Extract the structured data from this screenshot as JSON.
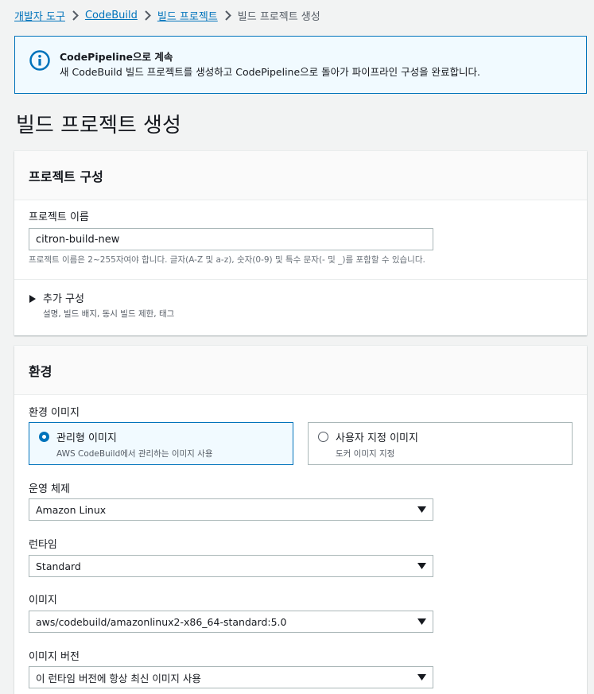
{
  "breadcrumb": {
    "items": [
      "개발자 도구",
      "CodeBuild",
      "빌드 프로젝트"
    ],
    "current": "빌드 프로젝트 생성"
  },
  "info": {
    "title": "CodePipeline으로 계속",
    "description": "새 CodeBuild 빌드 프로젝트를 생성하고 CodePipeline으로 돌아가 파이프라인 구성을 완료합니다."
  },
  "page_title": "빌드 프로젝트 생성",
  "project_config": {
    "header": "프로젝트 구성",
    "name_label": "프로젝트 이름",
    "name_value": "citron-build-new",
    "name_hint": "프로젝트 이름은 2~255자여야 합니다. 글자(A-Z 및 a-z), 숫자(0-9) 및 특수 문자(- 및 _)를 포함할 수 있습니다.",
    "additional": {
      "title": "추가 구성",
      "subtitle": "설명, 빌드 배지, 동시 빌드 제한, 태그"
    }
  },
  "environment": {
    "header": "환경",
    "image_label": "환경 이미지",
    "options": [
      {
        "title": "관리형 이미지",
        "subtitle": "AWS CodeBuild에서 관리하는 이미지 사용",
        "selected": true
      },
      {
        "title": "사용자 지정 이미지",
        "subtitle": "도커 이미지 지정",
        "selected": false
      }
    ],
    "os_label": "운영 체제",
    "os_value": "Amazon Linux",
    "runtime_label": "런타임",
    "runtime_value": "Standard",
    "image_select_label": "이미지",
    "image_value": "aws/codebuild/amazonlinux2-x86_64-standard:5.0",
    "version_label": "이미지 버전",
    "version_value": "이 런타임 버전에 항상 최신 이미지 사용"
  },
  "colors": {
    "link": "#0073bb",
    "info_bg": "#f1faff",
    "page_bg": "#f2f3f3"
  },
  "icons": [
    "chevron-right-icon",
    "info-icon",
    "caret-right-icon",
    "caret-down-icon"
  ]
}
